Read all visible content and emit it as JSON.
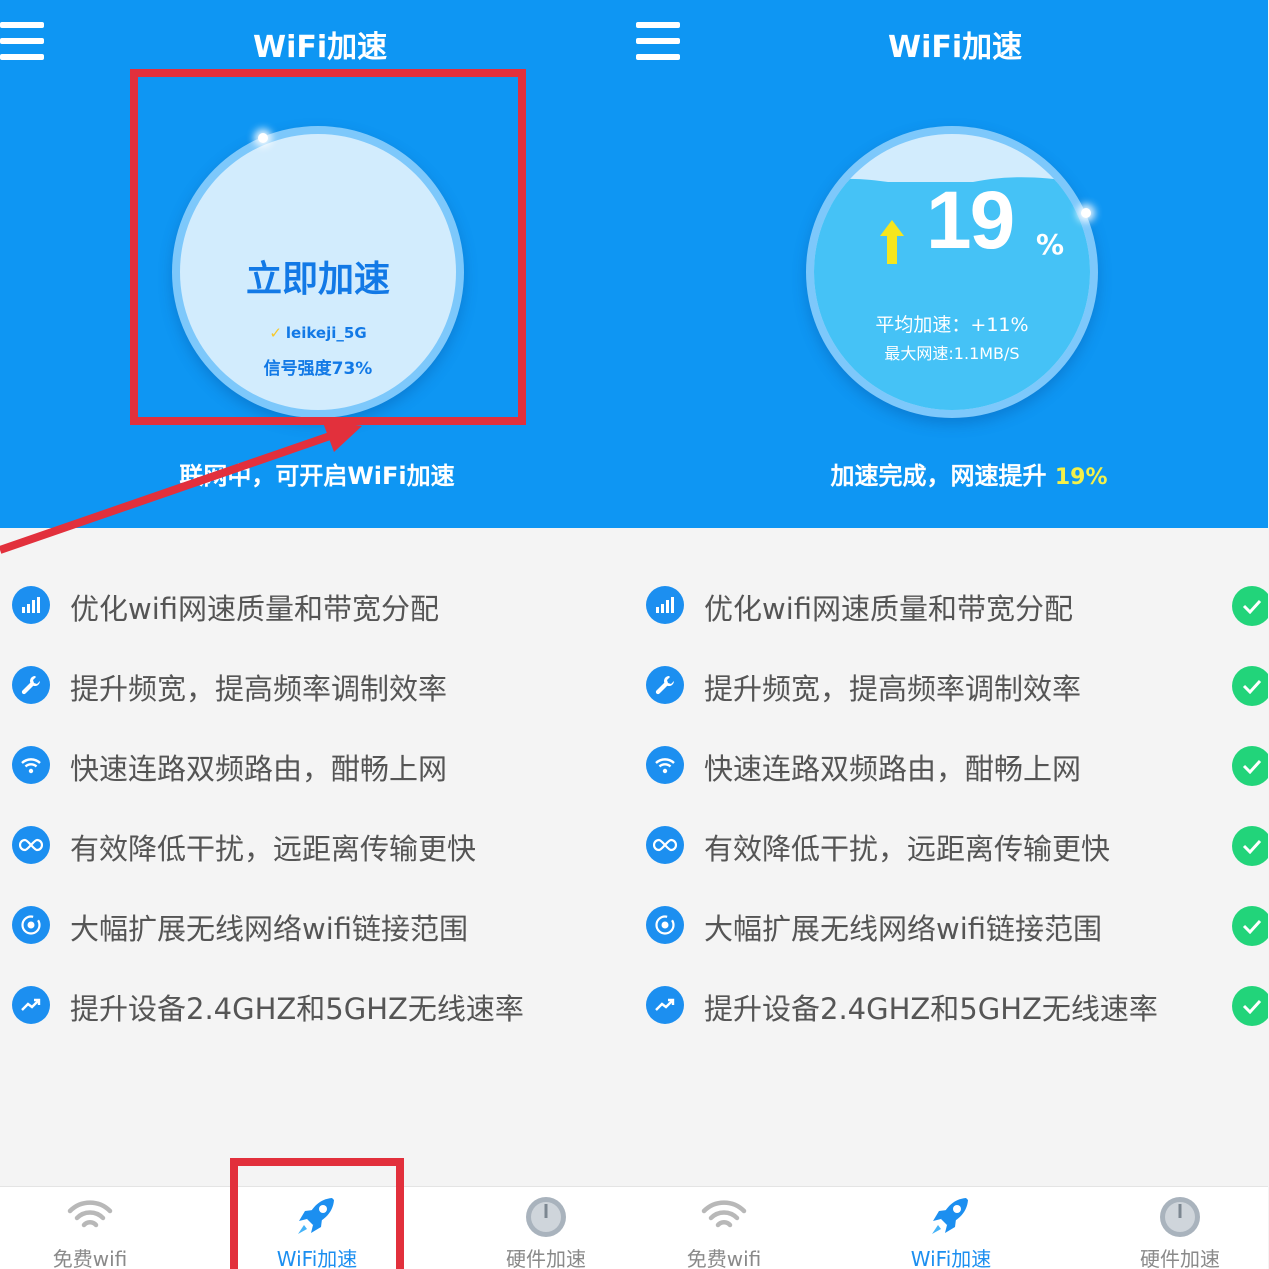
{
  "colors": {
    "header_bg": "#0e96f3",
    "accent_blue": "#1c8ff0",
    "check_green": "#22d47a",
    "highlight_yellow": "#f3f04a",
    "annotation_red": "#e2303c"
  },
  "left": {
    "title": "WiFi加速",
    "cta": "立即加速",
    "ssid": "leikeji_5G",
    "signal": "信号强度73%",
    "status": "联网中，可开启WiFi加速"
  },
  "right": {
    "title": "WiFi加速",
    "percent": "19",
    "percent_sign": "%",
    "avg_speedup": "平均加速：+11%",
    "max_speed": "最大网速:1.1MB/S",
    "status_prefix": "加速完成，网速提升 ",
    "status_value": "19%"
  },
  "features": [
    {
      "icon": "signal-bars-icon",
      "text": "优化wifi网速质量和带宽分配"
    },
    {
      "icon": "wrench-icon",
      "text": "提升频宽，提高频率调制效率"
    },
    {
      "icon": "wifi-icon",
      "text": "快速连路双频路由，酣畅上网"
    },
    {
      "icon": "infinity-icon",
      "text": "有效降低干扰，远距离传输更快"
    },
    {
      "icon": "target-icon",
      "text": "大幅扩展无线网络wifi链接范围"
    },
    {
      "icon": "trend-icon",
      "text": "提升设备2.4GHZ和5GHZ无线速率"
    }
  ],
  "tabs": [
    {
      "icon": "wifi-icon",
      "label": "免费wifi"
    },
    {
      "icon": "rocket-icon",
      "label": "WiFi加速"
    },
    {
      "icon": "gauge-icon",
      "label": "硬件加速"
    }
  ]
}
